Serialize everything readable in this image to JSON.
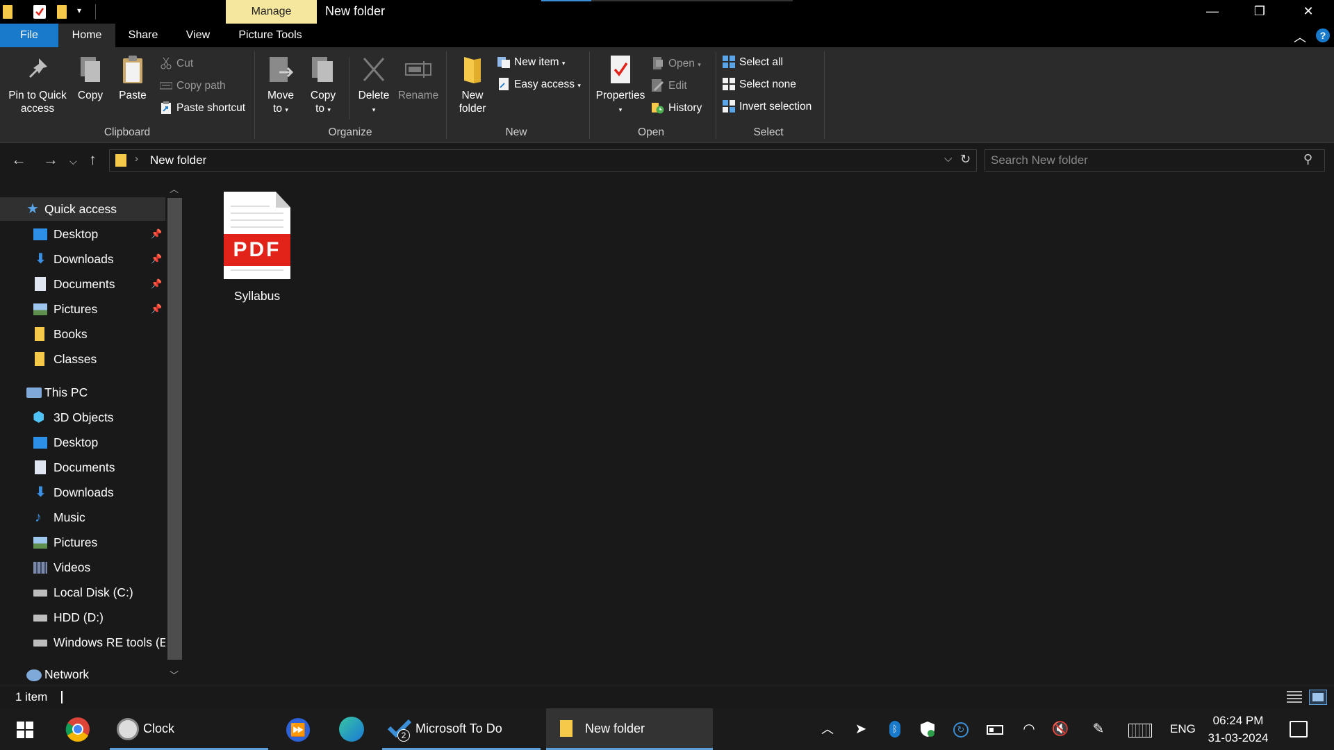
{
  "window": {
    "title": "New folder",
    "context_tab": "Manage",
    "controls": {
      "minimize": "—",
      "restore": "❐",
      "close": "✕"
    }
  },
  "ribbon_tabs": [
    "File",
    "Home",
    "Share",
    "View",
    "Picture Tools"
  ],
  "ribbon": {
    "clipboard": {
      "label": "Clipboard",
      "pin_line1": "Pin to Quick",
      "pin_line2": "access",
      "copy": "Copy",
      "paste": "Paste",
      "cut": "Cut",
      "copy_path": "Copy path",
      "paste_shortcut": "Paste shortcut"
    },
    "organize": {
      "label": "Organize",
      "move_line1": "Move",
      "move_line2": "to",
      "copy_line1": "Copy",
      "copy_line2": "to",
      "delete": "Delete",
      "rename": "Rename"
    },
    "new": {
      "label": "New",
      "new_folder_line1": "New",
      "new_folder_line2": "folder",
      "new_item": "New item",
      "easy_access": "Easy access"
    },
    "open": {
      "label": "Open",
      "properties": "Properties",
      "open": "Open",
      "edit": "Edit",
      "history": "History"
    },
    "select": {
      "label": "Select",
      "select_all": "Select all",
      "select_none": "Select none",
      "invert_selection": "Invert selection"
    }
  },
  "address": {
    "path": "New folder",
    "search_placeholder": "Search New folder"
  },
  "nav": {
    "quick_access": "Quick access",
    "quick_items": [
      "Desktop",
      "Downloads",
      "Documents",
      "Pictures",
      "Books",
      "Classes"
    ],
    "this_pc": "This PC",
    "pc_items": [
      "3D Objects",
      "Desktop",
      "Documents",
      "Downloads",
      "Music",
      "Pictures",
      "Videos",
      "Local Disk (C:)",
      "HDD (D:)",
      "Windows RE tools (E"
    ],
    "network": "Network"
  },
  "content": {
    "files": [
      {
        "name": "Syllabus",
        "type_label": "PDF"
      }
    ]
  },
  "status": {
    "item_count": "1 item"
  },
  "taskbar": {
    "apps": [
      "Clock",
      "Microsoft To Do",
      "New folder"
    ],
    "todo_badge": "2",
    "language": "ENG",
    "time": "06:24 PM",
    "date": "31-03-2024"
  }
}
